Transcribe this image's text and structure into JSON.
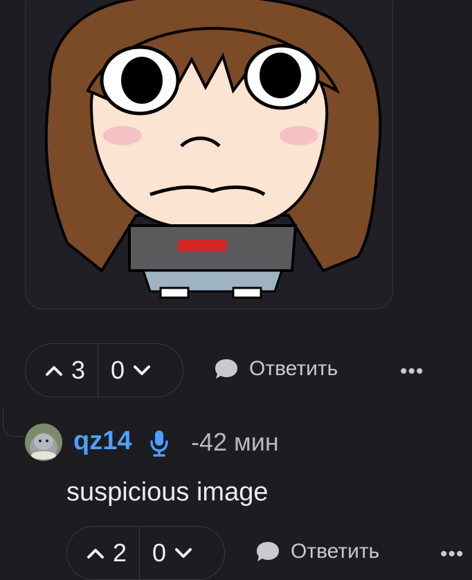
{
  "post": {
    "votes_up": "3",
    "votes_down": "0",
    "reply_label": "Ответить",
    "more_label": "•••"
  },
  "comment": {
    "username": "qz14",
    "time": "-42 мин",
    "text": "suspicious image",
    "votes_up": "2",
    "votes_down": "0",
    "reply_label": "Ответить",
    "more_label": "•••"
  },
  "icons": {
    "upvote": "chevron-up-icon",
    "downvote": "chevron-down-icon",
    "reply": "speech-bubble-icon",
    "mic": "microphone-icon"
  },
  "colors": {
    "background": "#1c1c21",
    "username": "#4f9fff",
    "border": "#3a3a43"
  }
}
